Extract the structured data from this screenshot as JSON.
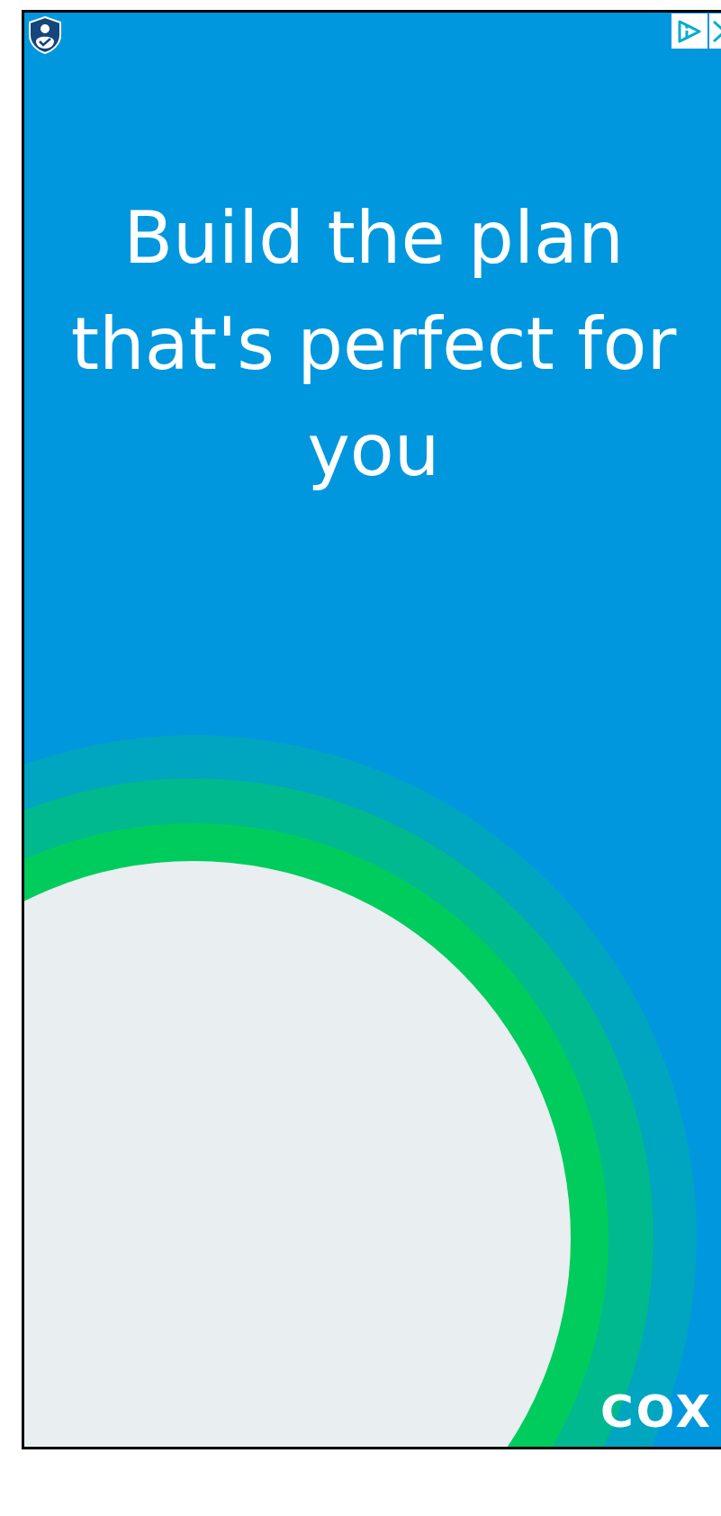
{
  "headline": "Build the plan that's perfect for you",
  "logo": "COX"
}
